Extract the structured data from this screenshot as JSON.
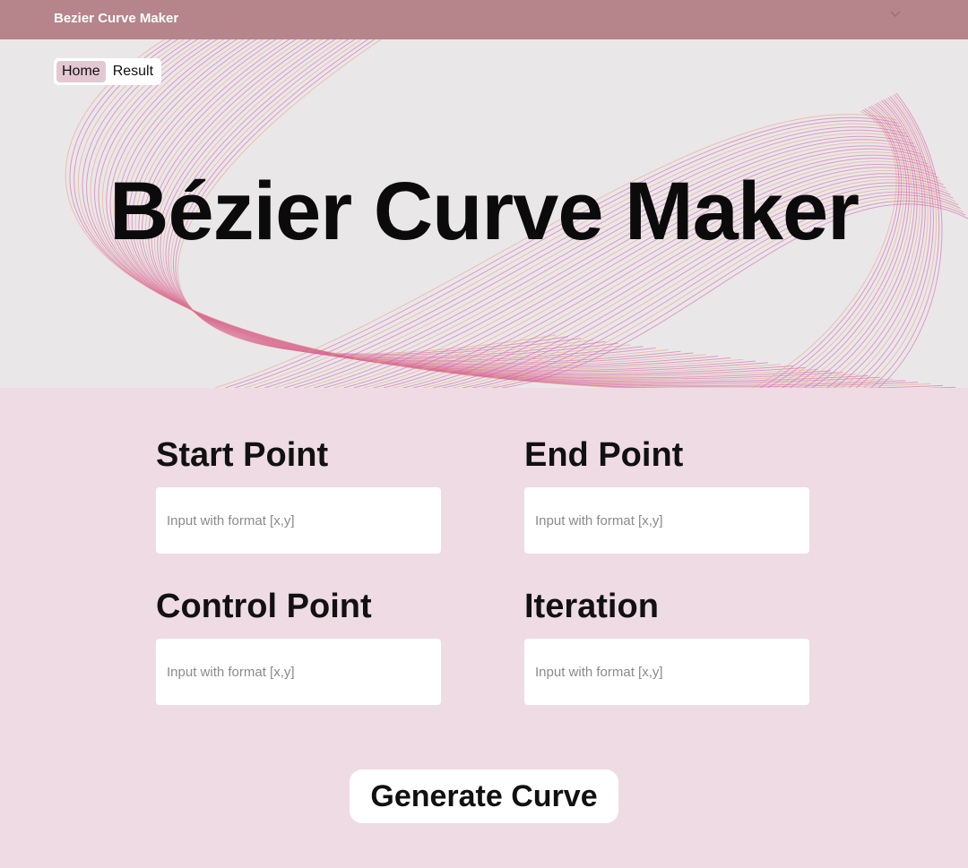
{
  "header": {
    "app_title": "Bezier Curve Maker"
  },
  "nav": {
    "tabs": [
      {
        "label": "Home"
      },
      {
        "label": "Result"
      }
    ]
  },
  "hero": {
    "title": "Bézier Curve Maker"
  },
  "form": {
    "start": {
      "label": "Start Point",
      "placeholder": "Input with format [x,y]"
    },
    "end": {
      "label": "End Point",
      "placeholder": "Input with format [x,y]"
    },
    "control": {
      "label": "Control Point",
      "placeholder": "Input with format [x,y]"
    },
    "iteration": {
      "label": "Iteration",
      "placeholder": "Input with format [x,y]"
    },
    "submit_label": "Generate Curve"
  },
  "colors": {
    "topbar": "#b5858b",
    "page_background": "#efdbe4",
    "hero_background": "#eae7e9",
    "active_tab": "#e3c8d3",
    "curve_pink": "#d55aa0",
    "curve_orange": "#e6a07a"
  },
  "icons": {
    "topbar_chevron": "chevron-down-icon"
  }
}
